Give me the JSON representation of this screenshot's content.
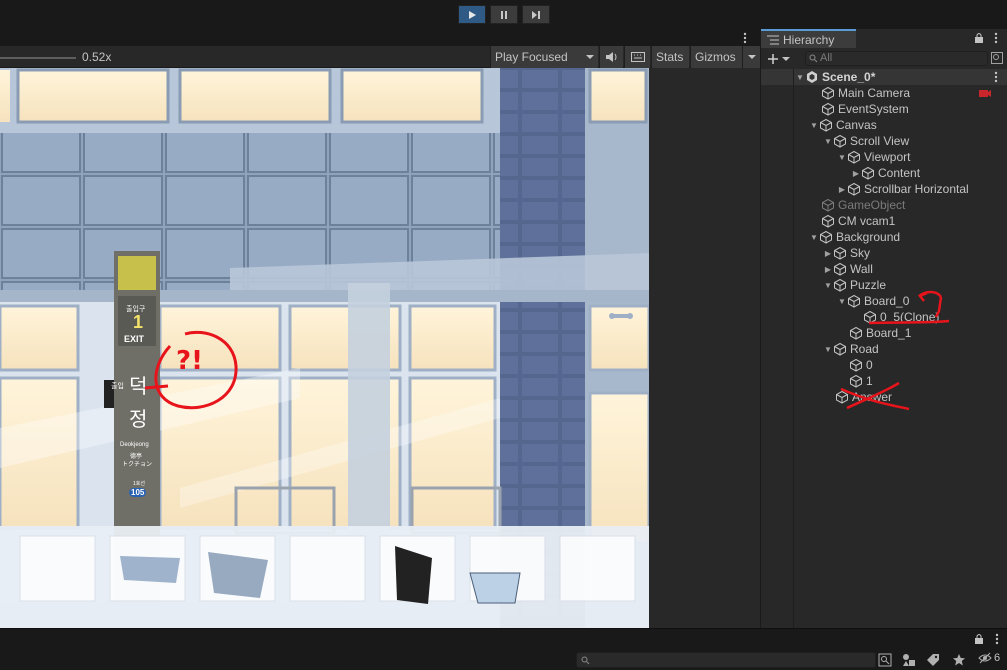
{
  "toolbar": {
    "play_icon": "play-icon",
    "pause_icon": "pause-icon",
    "step_icon": "step-icon"
  },
  "game_view": {
    "scale_label": "0.52x",
    "scale_value": 0.52,
    "play_focused_label": "Play Focused",
    "stats_label": "Stats",
    "gizmos_label": "Gizmos"
  },
  "scene_art": {
    "sign_entrance_small": "출입구",
    "sign_number": "1",
    "sign_exit": "EXIT",
    "sign_small_2": "출입",
    "sign_station_1": "덕",
    "sign_station_2": "정",
    "sign_roman": "Deokjeong",
    "sign_cn": "德亭",
    "sign_jp": "トクチョン",
    "sign_code_small": "1호선",
    "sign_code": "105",
    "annotation": "?!"
  },
  "hierarchy": {
    "tab_label": "Hierarchy",
    "search_placeholder": "All",
    "scene_name": "Scene_0*",
    "items": [
      {
        "label": "Main Camera"
      },
      {
        "label": "EventSystem"
      },
      {
        "label": "Canvas"
      },
      {
        "label": "Scroll View"
      },
      {
        "label": "Viewport"
      },
      {
        "label": "Content"
      },
      {
        "label": "Scrollbar Horizontal"
      },
      {
        "label": "GameObject"
      },
      {
        "label": "CM vcam1"
      },
      {
        "label": "Background"
      },
      {
        "label": "Sky"
      },
      {
        "label": "Wall"
      },
      {
        "label": "Puzzle"
      },
      {
        "label": "Board_0"
      },
      {
        "label": "0_5(Clone)"
      },
      {
        "label": "Board_1"
      },
      {
        "label": "Road"
      },
      {
        "label": "0"
      },
      {
        "label": "1"
      },
      {
        "label": "Answer"
      }
    ]
  },
  "bottom": {
    "hidden_count": "6"
  },
  "colors": {
    "accent": "#2f5a86",
    "annotation_red": "#e8141b",
    "panel": "#282828"
  }
}
